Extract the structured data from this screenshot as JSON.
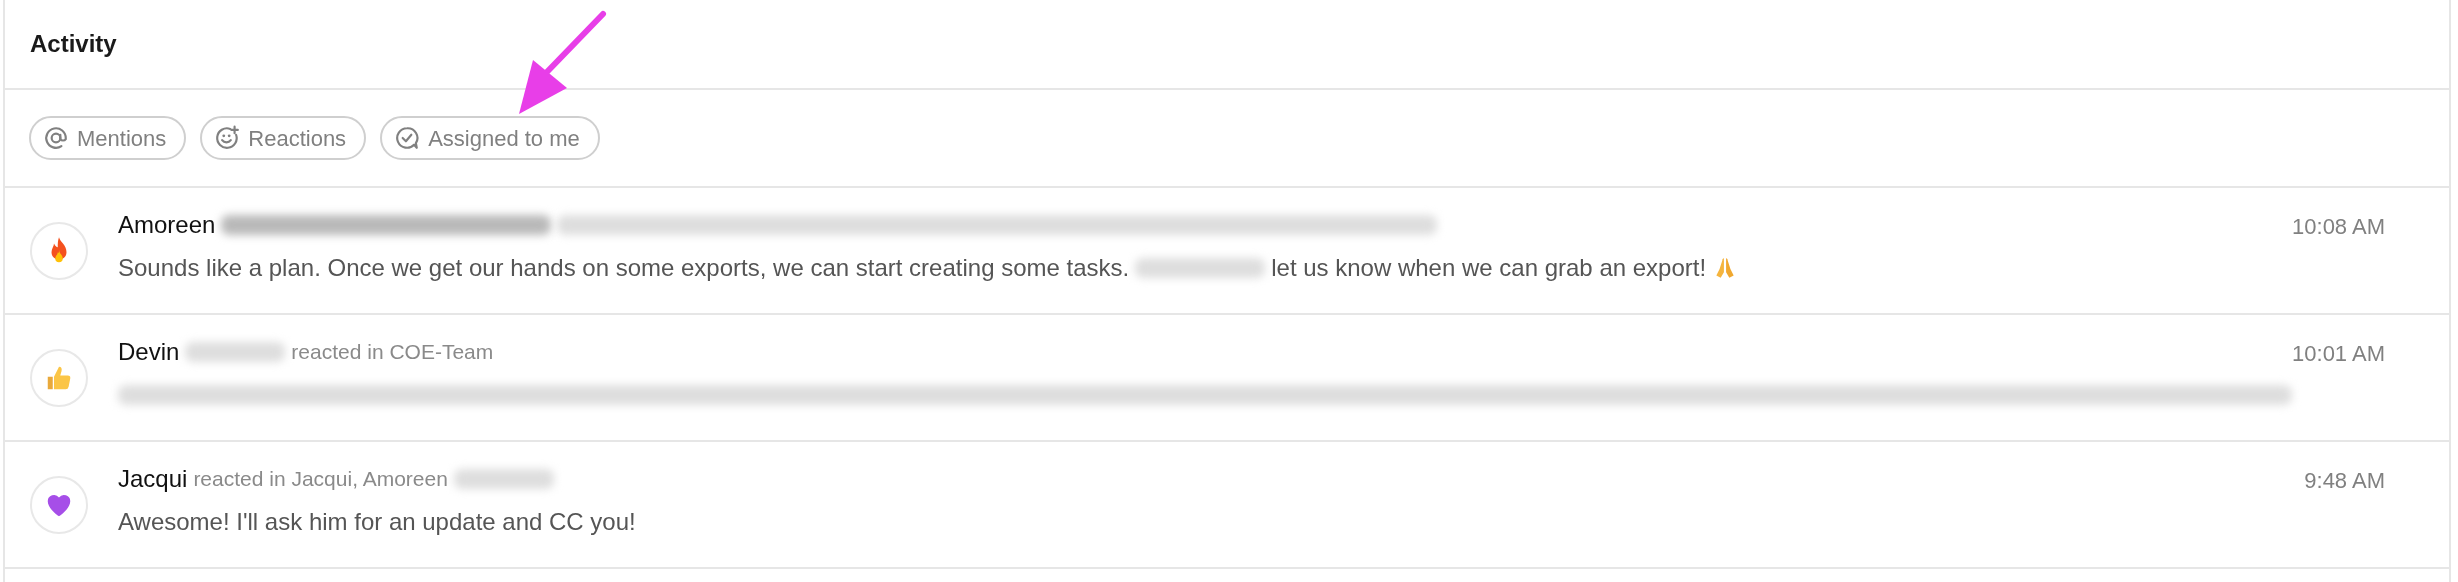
{
  "panel": {
    "title": "Activity"
  },
  "filters": [
    {
      "label": "Mentions",
      "kind": "mention",
      "selected": false
    },
    {
      "label": "Reactions",
      "kind": "reaction",
      "selected": false
    },
    {
      "label": "Assigned to me",
      "kind": "assigned",
      "selected": false
    }
  ],
  "annotation": {
    "kind": "arrow"
  },
  "activities": [
    {
      "kind": "fire",
      "time": "10:08 AM",
      "header": [
        {
          "kind": "name",
          "text": "Amoreen"
        },
        {
          "kind": "darkblur"
        },
        {
          "kind": "widerblur"
        }
      ],
      "message": [
        {
          "kind": "text",
          "text": "Sounds like a plan. Once we get our hands on some exports, we can start creating some tasks."
        },
        {
          "kind": "mediumblur"
        },
        {
          "kind": "text",
          "text": "let us know when we can grab an export!"
        },
        {
          "kind": "pray"
        }
      ]
    },
    {
      "kind": "thumbsup",
      "time": "10:01 AM",
      "header": [
        {
          "kind": "name",
          "text": "Devin"
        },
        {
          "kind": "shortblur"
        },
        {
          "kind": "meta",
          "text": "reacted in COE-Team"
        }
      ],
      "message": [
        {
          "kind": "fullblur"
        }
      ]
    },
    {
      "kind": "heart",
      "time": "9:48 AM",
      "header": [
        {
          "kind": "name",
          "text": "Jacqui"
        },
        {
          "kind": "meta",
          "text": "reacted in Jacqui, Amoreen"
        },
        {
          "kind": "shortblur"
        }
      ],
      "message": [
        {
          "kind": "text",
          "text": "Awesome! I'll ask him for an update and CC you!"
        }
      ]
    }
  ]
}
